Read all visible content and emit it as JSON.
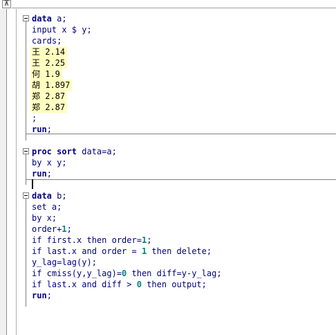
{
  "window": {
    "corner_icon": "⊼"
  },
  "blocks": [
    {
      "lines": [
        {
          "kind": "kw",
          "parts": [
            {
              "c": "b",
              "t": "data"
            },
            {
              "c": "",
              "t": " a;"
            }
          ]
        },
        {
          "kind": "kw",
          "parts": [
            {
              "c": "",
              "t": "input x $ y;"
            }
          ]
        },
        {
          "kind": "kw",
          "parts": [
            {
              "c": "",
              "t": "cards;"
            }
          ]
        },
        {
          "kind": "data-row",
          "parts": [
            {
              "c": "p",
              "t": "王 2.14"
            }
          ]
        },
        {
          "kind": "data-row",
          "parts": [
            {
              "c": "p",
              "t": "王 2.25"
            }
          ]
        },
        {
          "kind": "data-row",
          "parts": [
            {
              "c": "p",
              "t": "何 1.9"
            }
          ]
        },
        {
          "kind": "data-row",
          "parts": [
            {
              "c": "p",
              "t": "胡 1.897"
            }
          ]
        },
        {
          "kind": "data-row",
          "parts": [
            {
              "c": "p",
              "t": "郑 2.87"
            }
          ]
        },
        {
          "kind": "data-row",
          "parts": [
            {
              "c": "p",
              "t": "郑 2.87"
            }
          ]
        },
        {
          "kind": "kw",
          "parts": [
            {
              "c": "",
              "t": ";"
            }
          ]
        },
        {
          "kind": "kw",
          "parts": [
            {
              "c": "b",
              "t": "run"
            },
            {
              "c": "",
              "t": ";"
            }
          ]
        }
      ]
    },
    {
      "lines": [
        {
          "kind": "kw",
          "parts": [
            {
              "c": "b",
              "t": "proc sort"
            },
            {
              "c": "",
              "t": " data=a;"
            }
          ]
        },
        {
          "kind": "kw",
          "parts": [
            {
              "c": "",
              "t": "by x y;"
            }
          ]
        },
        {
          "kind": "kw",
          "parts": [
            {
              "c": "b",
              "t": "run"
            },
            {
              "c": "",
              "t": ";"
            }
          ]
        }
      ]
    },
    {
      "lines": [
        {
          "kind": "kw",
          "parts": [
            {
              "c": "b",
              "t": "data"
            },
            {
              "c": "",
              "t": " b;"
            }
          ]
        },
        {
          "kind": "kw",
          "parts": [
            {
              "c": "",
              "t": "set a;"
            }
          ]
        },
        {
          "kind": "kw",
          "parts": [
            {
              "c": "",
              "t": "by x;"
            }
          ]
        },
        {
          "kind": "kw",
          "parts": [
            {
              "c": "",
              "t": "order+"
            },
            {
              "c": "n",
              "t": "1"
            },
            {
              "c": "",
              "t": ";"
            }
          ]
        },
        {
          "kind": "kw",
          "parts": [
            {
              "c": "",
              "t": "if first.x then order="
            },
            {
              "c": "n",
              "t": "1"
            },
            {
              "c": "",
              "t": ";"
            }
          ]
        },
        {
          "kind": "kw",
          "parts": [
            {
              "c": "",
              "t": "if last.x and order = "
            },
            {
              "c": "n",
              "t": "1"
            },
            {
              "c": "",
              "t": " then delete;"
            }
          ]
        },
        {
          "kind": "kw",
          "parts": [
            {
              "c": "",
              "t": "y_lag=lag(y);"
            }
          ]
        },
        {
          "kind": "kw",
          "parts": [
            {
              "c": "",
              "t": "if cmiss(y,y_lag)="
            },
            {
              "c": "n",
              "t": "0"
            },
            {
              "c": "",
              "t": " then diff=y-y_lag;"
            }
          ]
        },
        {
          "kind": "kw",
          "parts": [
            {
              "c": "",
              "t": "if last.x and diff > "
            },
            {
              "c": "n",
              "t": "0"
            },
            {
              "c": "",
              "t": " then output;"
            }
          ]
        },
        {
          "kind": "kw",
          "parts": [
            {
              "c": "b",
              "t": "run"
            },
            {
              "c": "",
              "t": ";"
            }
          ]
        }
      ]
    }
  ]
}
